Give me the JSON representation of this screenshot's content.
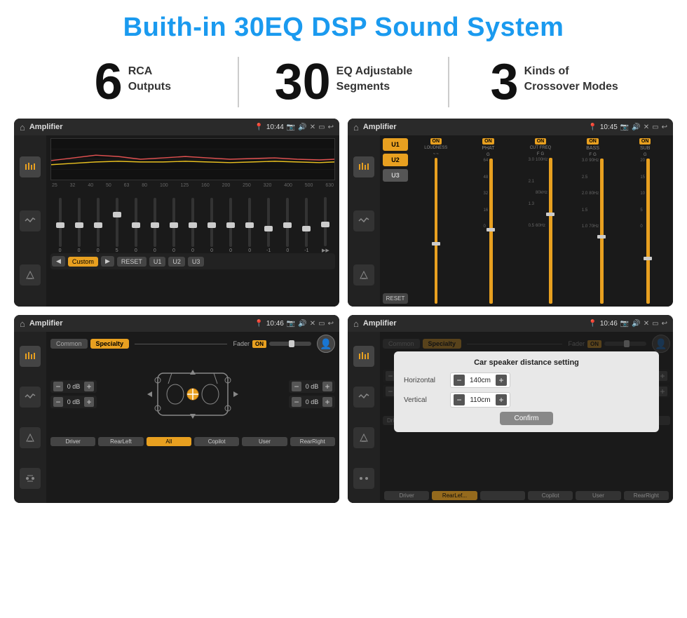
{
  "header": {
    "title": "Buith-in 30EQ DSP Sound System"
  },
  "stats": [
    {
      "number": "6",
      "line1": "RCA",
      "line2": "Outputs"
    },
    {
      "number": "30",
      "line1": "EQ Adjustable",
      "line2": "Segments"
    },
    {
      "number": "3",
      "line1": "Kinds of",
      "line2": "Crossover Modes"
    }
  ],
  "screens": [
    {
      "id": "eq-screen",
      "topbar": {
        "title": "Amplifier",
        "time": "10:44"
      },
      "type": "eq"
    },
    {
      "id": "amp-screen",
      "topbar": {
        "title": "Amplifier",
        "time": "10:45"
      },
      "type": "amp"
    },
    {
      "id": "cross-screen",
      "topbar": {
        "title": "Amplifier",
        "time": "10:46"
      },
      "type": "cross"
    },
    {
      "id": "dialog-screen",
      "topbar": {
        "title": "Amplifier",
        "time": "10:46"
      },
      "type": "dialog",
      "dialog": {
        "title": "Car speaker distance setting",
        "horizontal_label": "Horizontal",
        "horizontal_value": "140cm",
        "vertical_label": "Vertical",
        "vertical_value": "110cm",
        "confirm_label": "Confirm"
      }
    }
  ],
  "eq": {
    "freqs": [
      "25",
      "32",
      "40",
      "50",
      "63",
      "80",
      "100",
      "125",
      "160",
      "200",
      "250",
      "320",
      "400",
      "500",
      "630"
    ],
    "values": [
      "0",
      "0",
      "0",
      "5",
      "0",
      "0",
      "0",
      "0",
      "0",
      "0",
      "0",
      "-1",
      "0",
      "-1",
      ""
    ],
    "presets": [
      "Custom",
      "RESET",
      "U1",
      "U2",
      "U3"
    ]
  },
  "amp": {
    "presets": [
      "U1",
      "U2",
      "U3"
    ],
    "channels": [
      {
        "label": "LOUDNESS",
        "on": true
      },
      {
        "label": "PHAT",
        "on": true
      },
      {
        "label": "CUT FREQ",
        "on": true
      },
      {
        "label": "BASS",
        "on": true
      },
      {
        "label": "SUB",
        "on": true
      }
    ]
  },
  "cross": {
    "tabs": [
      "Common",
      "Specialty"
    ],
    "fader_label": "Fader",
    "fader_on": "ON",
    "db_rows": [
      {
        "val": "0 dB"
      },
      {
        "val": "0 dB"
      },
      {
        "val": "0 dB"
      },
      {
        "val": "0 dB"
      }
    ],
    "nav_btns": [
      "Driver",
      "RearLeft",
      "All",
      "Copilot",
      "User",
      "RearRight"
    ]
  },
  "dialog": {
    "title": "Car speaker distance setting",
    "horizontal_label": "Horizontal",
    "horizontal_value": "140cm",
    "vertical_label": "Vertical",
    "vertical_value": "110cm",
    "confirm_label": "Confirm"
  }
}
